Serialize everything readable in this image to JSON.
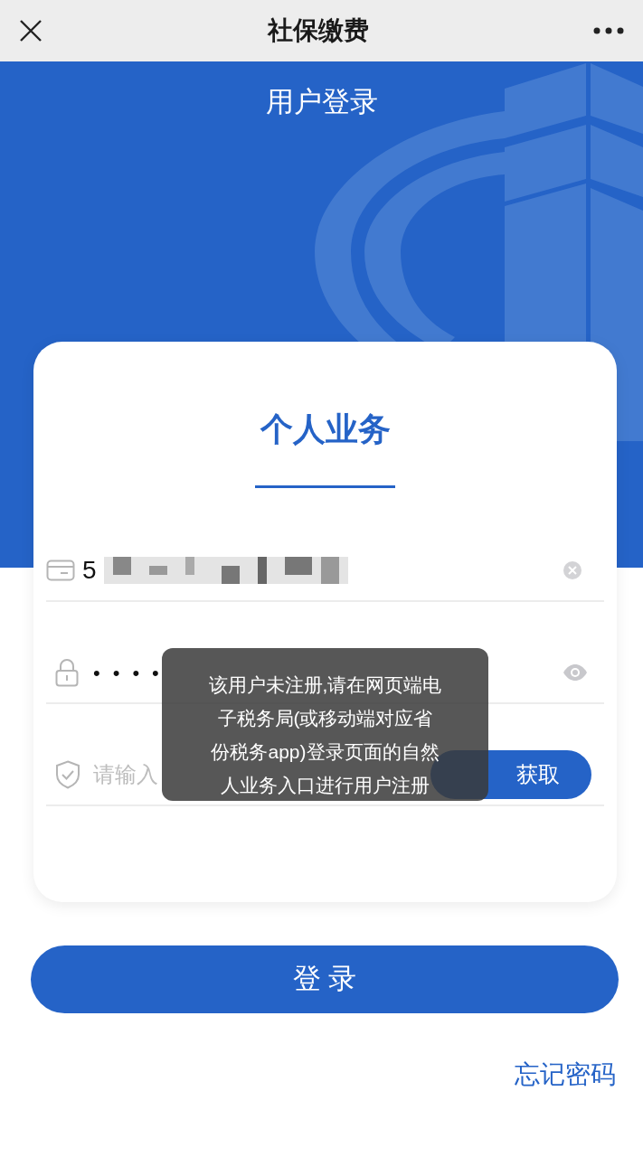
{
  "top_bar": {
    "title": "社保缴费"
  },
  "header": {
    "title": "用户登录"
  },
  "card": {
    "title": "个人业务",
    "fields": [
      {
        "kind": "id",
        "value": "5",
        "redacted": true
      },
      {
        "kind": "password",
        "value": "••••"
      },
      {
        "kind": "captcha",
        "placeholder": "请输入",
        "button": "获取"
      }
    ]
  },
  "login_button": "登 录",
  "forgot_link": "忘记密码",
  "toast": {
    "lines": [
      "该用户未注册,请在网页端电",
      "子税务局(或移动端对应省",
      "份税务app)登录页面的自然",
      "人业务入口进行用户注册"
    ]
  }
}
